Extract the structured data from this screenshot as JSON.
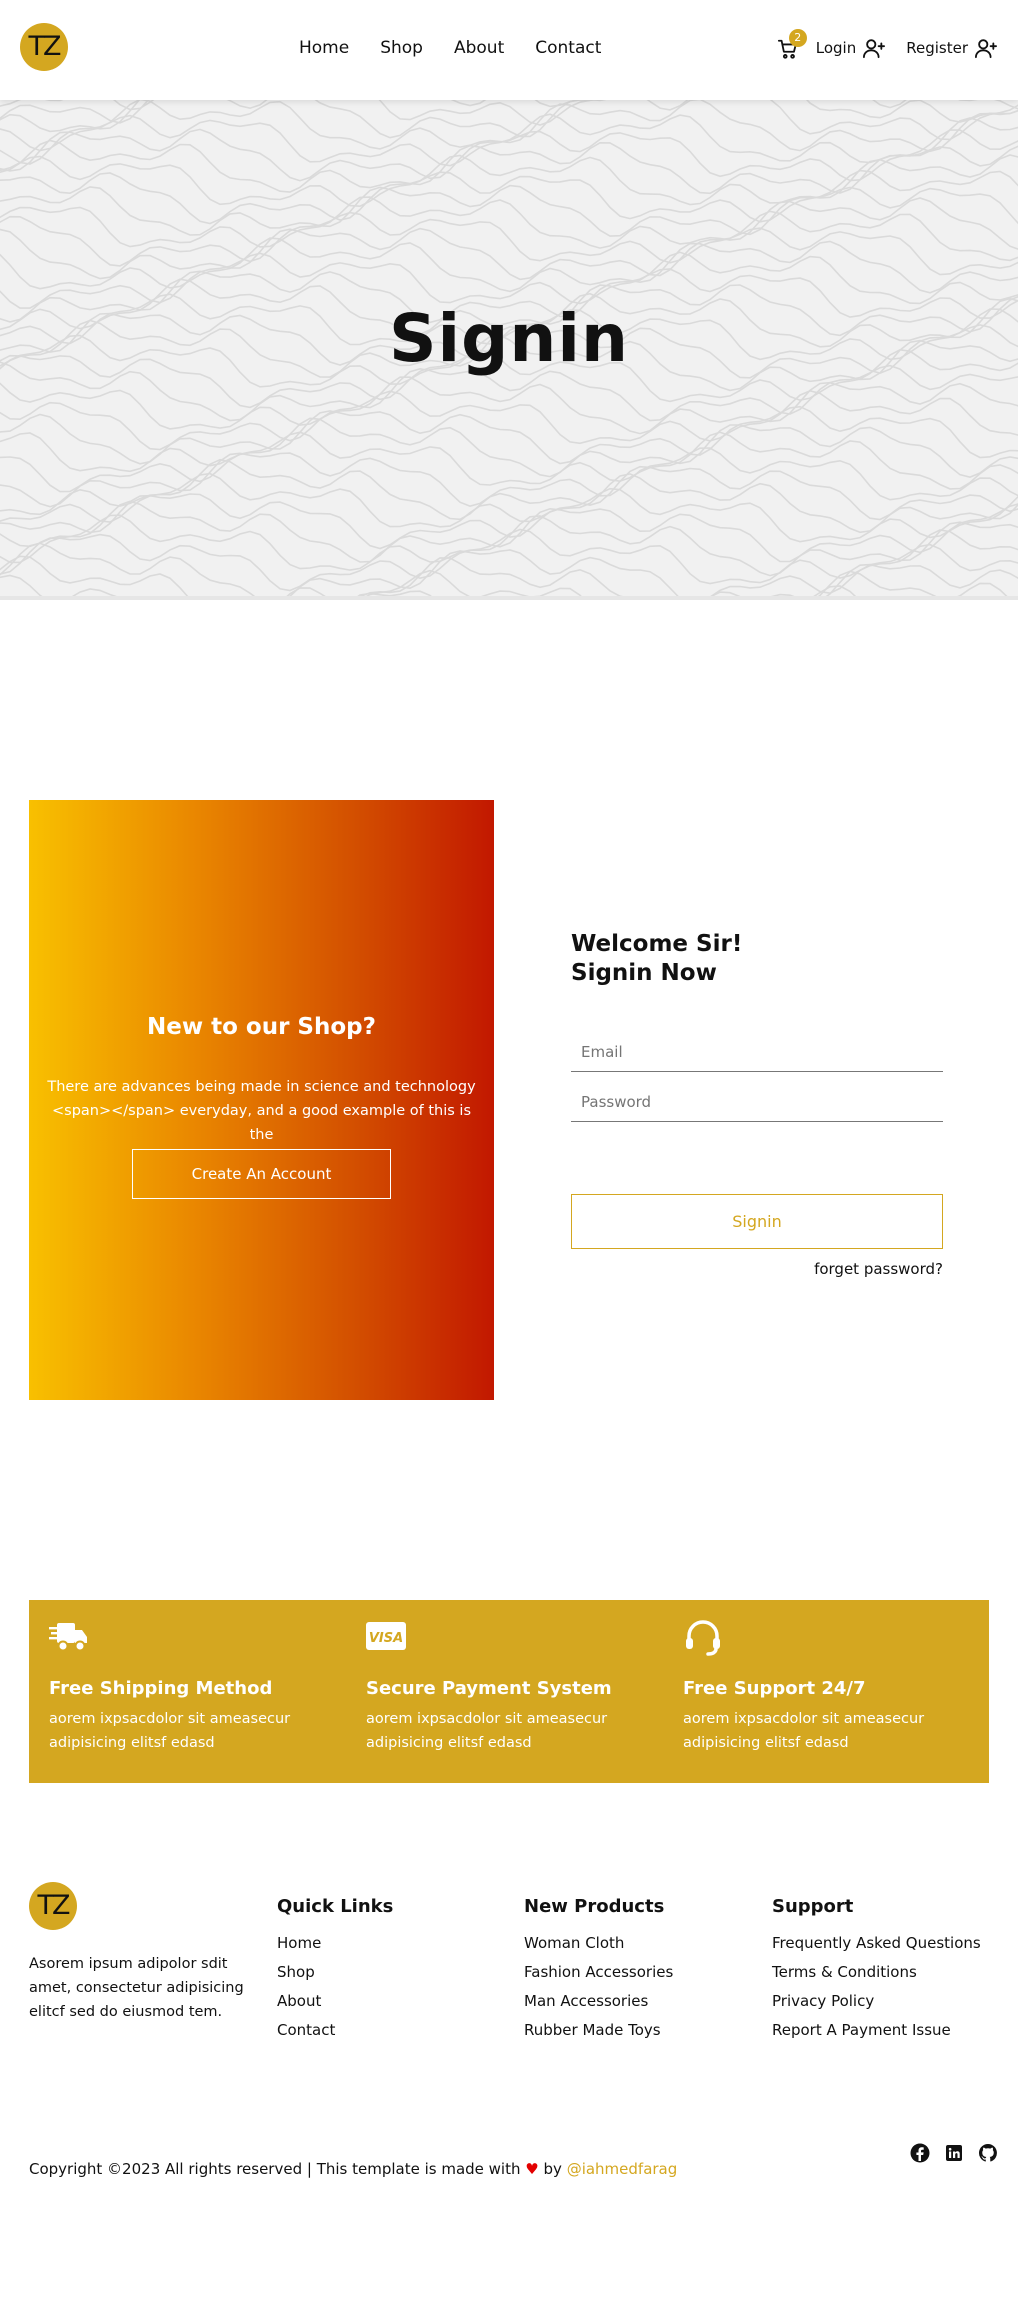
{
  "header": {
    "logo_text": "TZ",
    "nav": [
      "Home",
      "Shop",
      "About",
      "Contact"
    ],
    "cart_count": "2",
    "login_label": "Login",
    "register_label": "Register"
  },
  "hero": {
    "title": "Signin"
  },
  "promo": {
    "heading": "New to our Shop?",
    "text": "There are advances being made in science and technology <span></span> everyday, and a good example of this is the",
    "button": "Create An Account"
  },
  "login": {
    "heading_line1": "Welcome Sir!",
    "heading_line2": "Signin Now",
    "email_placeholder": "Email",
    "password_placeholder": "Password",
    "submit": "Signin",
    "forgot": "forget password?"
  },
  "features": [
    {
      "icon": "truck-icon",
      "title": "Free Shipping Method",
      "text": "aorem ixpsacdolor sit ameasecur adipisicing elitsf edasd"
    },
    {
      "icon": "visa-icon",
      "title": "Secure Payment System",
      "text": "aorem ixpsacdolor sit ameasecur adipisicing elitsf edasd"
    },
    {
      "icon": "headset-icon",
      "title": "Free Support 24/7",
      "text": "aorem ixpsacdolor sit ameasecur adipisicing elitsf edasd"
    }
  ],
  "footer": {
    "logo_text": "TZ",
    "description": "Asorem ipsum adipolor sdit amet, consectetur adipisicing elitcf sed do eiusmod tem.",
    "quick_links": {
      "title": "Quick Links",
      "items": [
        "Home",
        "Shop",
        "About",
        "Contact"
      ]
    },
    "new_products": {
      "title": "New Products",
      "items": [
        "Woman Cloth",
        "Fashion Accessories",
        "Man Accessories",
        "Rubber Made Toys"
      ]
    },
    "support": {
      "title": "Support",
      "items": [
        "Frequently Asked Questions",
        "Terms & Conditions",
        "Privacy Policy",
        "Report A Payment Issue"
      ]
    },
    "copyright_prefix": "Copyright ©2023 All rights reserved | This template is made with",
    "copyright_by": "by",
    "author": "@iahmedfarag",
    "social": [
      "facebook-icon",
      "linkedin-icon",
      "github-icon"
    ]
  },
  "colors": {
    "accent": "#d4a720",
    "gradient_start": "#f8c000",
    "gradient_end": "#c21800",
    "heart": "#e30000"
  }
}
